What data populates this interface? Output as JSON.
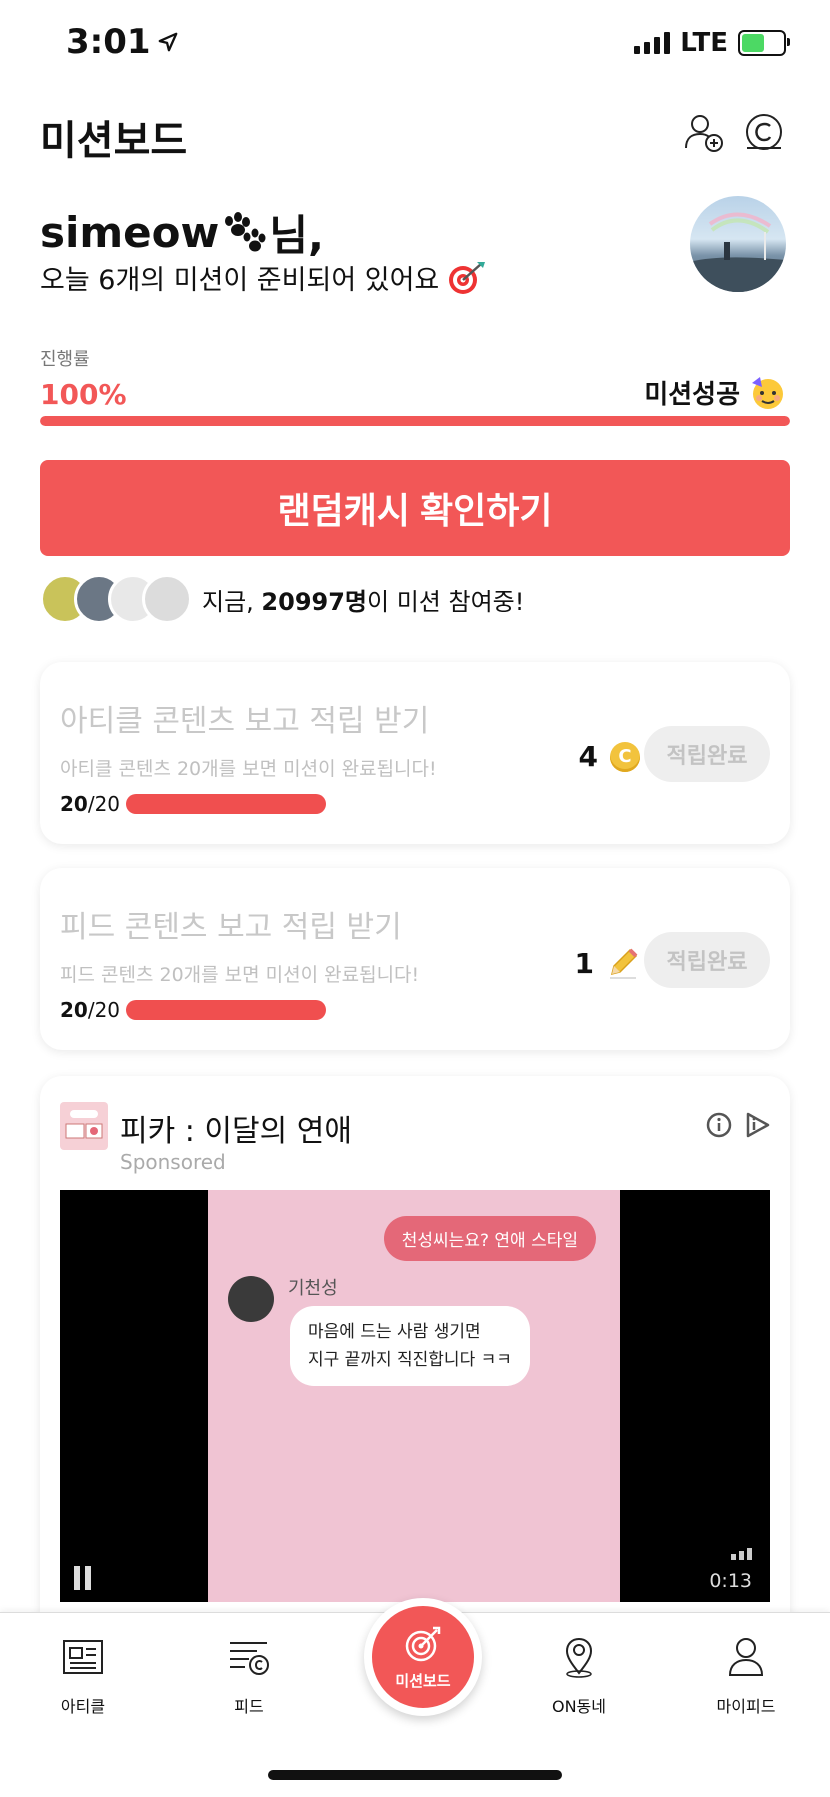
{
  "status_bar": {
    "time": "3:01",
    "network": "LTE",
    "battery_percent": 50
  },
  "header": {
    "title": "미션보드",
    "icons": [
      "add-friend-icon",
      "cash-icon"
    ]
  },
  "greeting": {
    "name": "simeow",
    "suffix": "님,",
    "subtitle": "오늘 6개의 미션이 준비되어 있어요"
  },
  "progress": {
    "label": "진행률",
    "percent_text": "100%",
    "percent_value": 100,
    "status": "미션성공"
  },
  "cta": {
    "label": "랜덤캐시 확인하기"
  },
  "participants": {
    "prefix": "지금, ",
    "count": "20997명",
    "suffix": "이 미션 참여중!"
  },
  "missions": [
    {
      "title": "아티클 콘텐츠 보고 적립 받기",
      "desc": "아티클 콘텐츠 20개를 보면 미션이 완료됩니다!",
      "done": "20",
      "total": "/20",
      "progress_value": 1.0,
      "reward": "4",
      "reward_icon": "coin-icon",
      "button": "적립완료"
    },
    {
      "title": "피드 콘텐츠 보고 적립 받기",
      "desc": "피드 콘텐츠 20개를 보면 미션이 완료됩니다!",
      "done": "20",
      "total": "/20",
      "progress_value": 1.0,
      "reward": "1",
      "reward_icon": "pencil-icon",
      "button": "적립완료"
    }
  ],
  "ad": {
    "title": "피카 : 이달의 연애",
    "sponsored": "Sponsored",
    "chat_right": "천성씨는요? 연애 스타일",
    "chat_name": "기천성",
    "chat_left_1": "마음에 드는 사람 생기면",
    "chat_left_2": "지구 끝까지 직진합니다 ㅋㅋ",
    "video_time": "0:13"
  },
  "tabs": [
    {
      "label": "아티클",
      "icon": "article-icon"
    },
    {
      "label": "피드",
      "icon": "feed-icon"
    },
    {
      "label": "미션보드",
      "icon": "target-icon"
    },
    {
      "label": "ON동네",
      "icon": "location-icon"
    },
    {
      "label": "마이피드",
      "icon": "profile-icon"
    }
  ],
  "colors": {
    "accent": "#f25757",
    "muted": "#c8c8c8",
    "button_bg": "#eeeeee"
  }
}
